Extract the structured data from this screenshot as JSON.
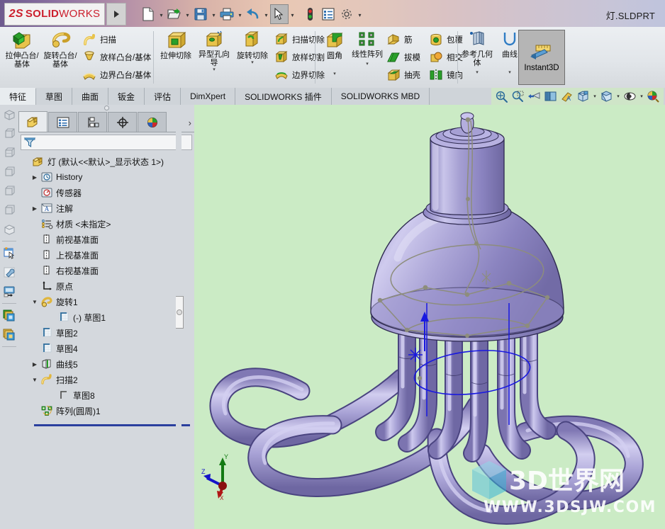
{
  "window": {
    "brand_ds": "2S",
    "brand_solid": "SOLID",
    "brand_works": "WORKS",
    "document_title": "灯.SLDPRT"
  },
  "quick_access": [
    {
      "name": "new-document",
      "icon": "new-file-icon",
      "caret": true
    },
    {
      "name": "open-document",
      "icon": "open-folder-icon",
      "caret": true
    },
    {
      "name": "save-document",
      "icon": "save-floppy-icon",
      "caret": true
    },
    {
      "name": "print-document",
      "icon": "printer-icon",
      "caret": true
    },
    {
      "name": "undo",
      "icon": "undo-arrow-icon",
      "caret": true
    },
    {
      "name": "select",
      "icon": "cursor-arrow-icon",
      "caret": true,
      "selected": true
    },
    {
      "name": "rebuild",
      "icon": "traffic-light-icon",
      "caret": false
    },
    {
      "name": "options-list",
      "icon": "list-properties-icon",
      "caret": false
    },
    {
      "name": "options",
      "icon": "gear-icon",
      "caret": true
    }
  ],
  "ribbon": {
    "groups": [
      {
        "name": "boss-base-group",
        "big": [
          {
            "label": "拉伸凸台/基体",
            "icon": "extrude-boss-icon",
            "dropdown": false
          },
          {
            "label": "旋转凸台/基体",
            "icon": "revolve-boss-icon",
            "dropdown": false
          }
        ],
        "small": [
          {
            "label": "扫描",
            "icon": "sweep-icon"
          },
          {
            "label": "放样凸台/基体",
            "icon": "loft-boss-icon"
          },
          {
            "label": "边界凸台/基体",
            "icon": "boundary-boss-icon"
          }
        ]
      },
      {
        "name": "cut-group",
        "big": [
          {
            "label": "拉伸切除",
            "icon": "extrude-cut-icon",
            "dropdown": false
          },
          {
            "label": "异型孔向导",
            "icon": "hole-wizard-icon",
            "dropdown": true
          },
          {
            "label": "旋转切除",
            "icon": "revolve-cut-icon",
            "dropdown": true
          }
        ],
        "small": [
          {
            "label": "扫描切除",
            "icon": "sweep-cut-icon"
          },
          {
            "label": "放样切割",
            "icon": "loft-cut-icon"
          },
          {
            "label": "边界切除",
            "icon": "boundary-cut-icon"
          }
        ]
      },
      {
        "name": "feature-group",
        "big": [
          {
            "label": "圆角",
            "icon": "fillet-icon",
            "dropdown": true
          },
          {
            "label": "线性阵列",
            "icon": "linear-pattern-icon",
            "dropdown": true
          }
        ],
        "small": [
          {
            "label": "筋",
            "icon": "rib-icon"
          },
          {
            "label": "拔模",
            "icon": "draft-icon"
          },
          {
            "label": "抽壳",
            "icon": "shell-icon"
          }
        ],
        "small2": [
          {
            "label": "包覆",
            "icon": "wrap-icon"
          },
          {
            "label": "相交",
            "icon": "intersect-icon"
          },
          {
            "label": "镜向",
            "icon": "mirror-icon"
          }
        ]
      },
      {
        "name": "reference-group",
        "big": [
          {
            "label": "参考几何体",
            "icon": "reference-geometry-icon",
            "dropdown": true
          },
          {
            "label": "曲线",
            "icon": "curves-icon",
            "dropdown": true
          }
        ]
      }
    ],
    "instant3d": {
      "label": "Instant3D",
      "icon": "instant3d-icon",
      "active": true
    }
  },
  "command_tabs": {
    "active_index": 0,
    "items": [
      {
        "label": "特征"
      },
      {
        "label": "草图"
      },
      {
        "label": "曲面"
      },
      {
        "label": "钣金"
      },
      {
        "label": "评估"
      },
      {
        "label": "DimXpert"
      },
      {
        "label": "SOLIDWORKS 插件"
      },
      {
        "label": "SOLIDWORKS MBD"
      }
    ]
  },
  "view_toolbar": [
    {
      "name": "zoom-to-fit",
      "icon": "zoom-fit-icon",
      "caret": false
    },
    {
      "name": "zoom-to-area",
      "icon": "zoom-area-icon",
      "caret": false
    },
    {
      "name": "previous-view",
      "icon": "previous-view-icon",
      "caret": false
    },
    {
      "name": "section-view",
      "icon": "section-view-icon",
      "caret": false
    },
    {
      "name": "view-orientation",
      "icon": "view-orientation-icon",
      "caret": false
    },
    {
      "name": "display-style",
      "icon": "display-style-icon",
      "caret": true
    },
    {
      "name": "hide-show-items",
      "icon": "hide-show-icon",
      "caret": true
    },
    {
      "name": "view-settings",
      "icon": "view-settings-icon",
      "caret": true
    },
    {
      "name": "apply-scene",
      "icon": "apply-scene-icon",
      "caret": false
    }
  ],
  "left_rail": [
    {
      "name": "display-state-1",
      "icon": "box-wire-icon"
    },
    {
      "name": "display-state-2",
      "icon": "box-wire-icon"
    },
    {
      "name": "display-state-3",
      "icon": "box-wire-icon"
    },
    {
      "name": "display-state-4",
      "icon": "box-wire-icon"
    },
    {
      "name": "display-state-5",
      "icon": "box-wire-icon"
    },
    {
      "name": "display-state-6",
      "icon": "box-wire-icon"
    },
    {
      "name": "display-state-7",
      "icon": "box-shaded-icon"
    },
    {
      "name": "new-selection",
      "icon": "new-window-cursor-icon"
    },
    {
      "name": "tools-wrench",
      "icon": "wrench-icon"
    },
    {
      "name": "screen-capture",
      "icon": "screen-out-icon"
    },
    {
      "name": "tile-windows-1",
      "icon": "tile-windows-icon"
    },
    {
      "name": "tile-windows-2",
      "icon": "tile-windows-icon"
    }
  ],
  "tree_panel": {
    "tabs": [
      {
        "name": "feature-manager-tab",
        "icon": "feature-tree-icon",
        "active": true
      },
      {
        "name": "property-manager-tab",
        "icon": "property-list-icon",
        "active": false
      },
      {
        "name": "configuration-manager-tab",
        "icon": "configuration-icon",
        "active": false
      },
      {
        "name": "dimxpert-manager-tab",
        "icon": "dimxpert-target-icon",
        "active": false
      },
      {
        "name": "display-manager-tab",
        "icon": "display-ball-icon",
        "active": false
      }
    ],
    "more_label": "›",
    "filter": {
      "icon": "filter-funnel-icon",
      "placeholder": "",
      "value": ""
    },
    "items": [
      {
        "label": "灯  (默认<<默认>_显示状态 1>)",
        "icon": "part-root-icon",
        "indent": 0,
        "expand": "none"
      },
      {
        "label": "History",
        "icon": "history-icon",
        "indent": 1,
        "expand": "collapsed"
      },
      {
        "label": "传感器",
        "icon": "sensor-icon",
        "indent": 1,
        "expand": "none"
      },
      {
        "label": "注解",
        "icon": "annotations-icon",
        "indent": 1,
        "expand": "collapsed"
      },
      {
        "label": "材质 <未指定>",
        "icon": "material-icon",
        "indent": 1,
        "expand": "none"
      },
      {
        "label": "前视基准面",
        "icon": "plane-icon",
        "indent": 1,
        "expand": "none"
      },
      {
        "label": "上视基准面",
        "icon": "plane-icon",
        "indent": 1,
        "expand": "none"
      },
      {
        "label": "右视基准面",
        "icon": "plane-icon",
        "indent": 1,
        "expand": "none"
      },
      {
        "label": "原点",
        "icon": "origin-icon",
        "indent": 1,
        "expand": "none"
      },
      {
        "label": "旋转1",
        "icon": "revolve-feature-icon",
        "indent": 1,
        "expand": "expanded"
      },
      {
        "label": "(-) 草图1",
        "icon": "sketch-icon",
        "indent": 2,
        "expand": "none"
      },
      {
        "label": "草图2",
        "icon": "sketch-icon",
        "indent": 1,
        "expand": "none"
      },
      {
        "label": "草图4",
        "icon": "sketch-icon",
        "indent": 1,
        "expand": "none"
      },
      {
        "label": "曲线5",
        "icon": "curve-feature-icon",
        "indent": 1,
        "expand": "collapsed"
      },
      {
        "label": "扫描2",
        "icon": "sweep-feature-icon",
        "indent": 1,
        "expand": "expanded"
      },
      {
        "label": "草图8",
        "icon": "sketch-plain-icon",
        "indent": 2,
        "expand": "none"
      },
      {
        "label": "阵列(圆周)1",
        "icon": "circular-pattern-icon",
        "indent": 1,
        "expand": "none"
      }
    ]
  },
  "graphics": {
    "background_color": "#cbebc5",
    "model_color": "#9a94cf",
    "model_highlight": "#d5d2ee",
    "model_shadow": "#6f68a8",
    "sketch_line_color": "#8a8a7a",
    "axis_color": "#2020e0",
    "triad": {
      "x_label": "X",
      "y_label": "Y",
      "z_label": "Z",
      "x_color": "#b01515",
      "y_color": "#137a13",
      "z_color": "#1414c8"
    },
    "watermark": {
      "line1": "3D世界网",
      "line2": "WWW.3DSJW.COM"
    }
  }
}
